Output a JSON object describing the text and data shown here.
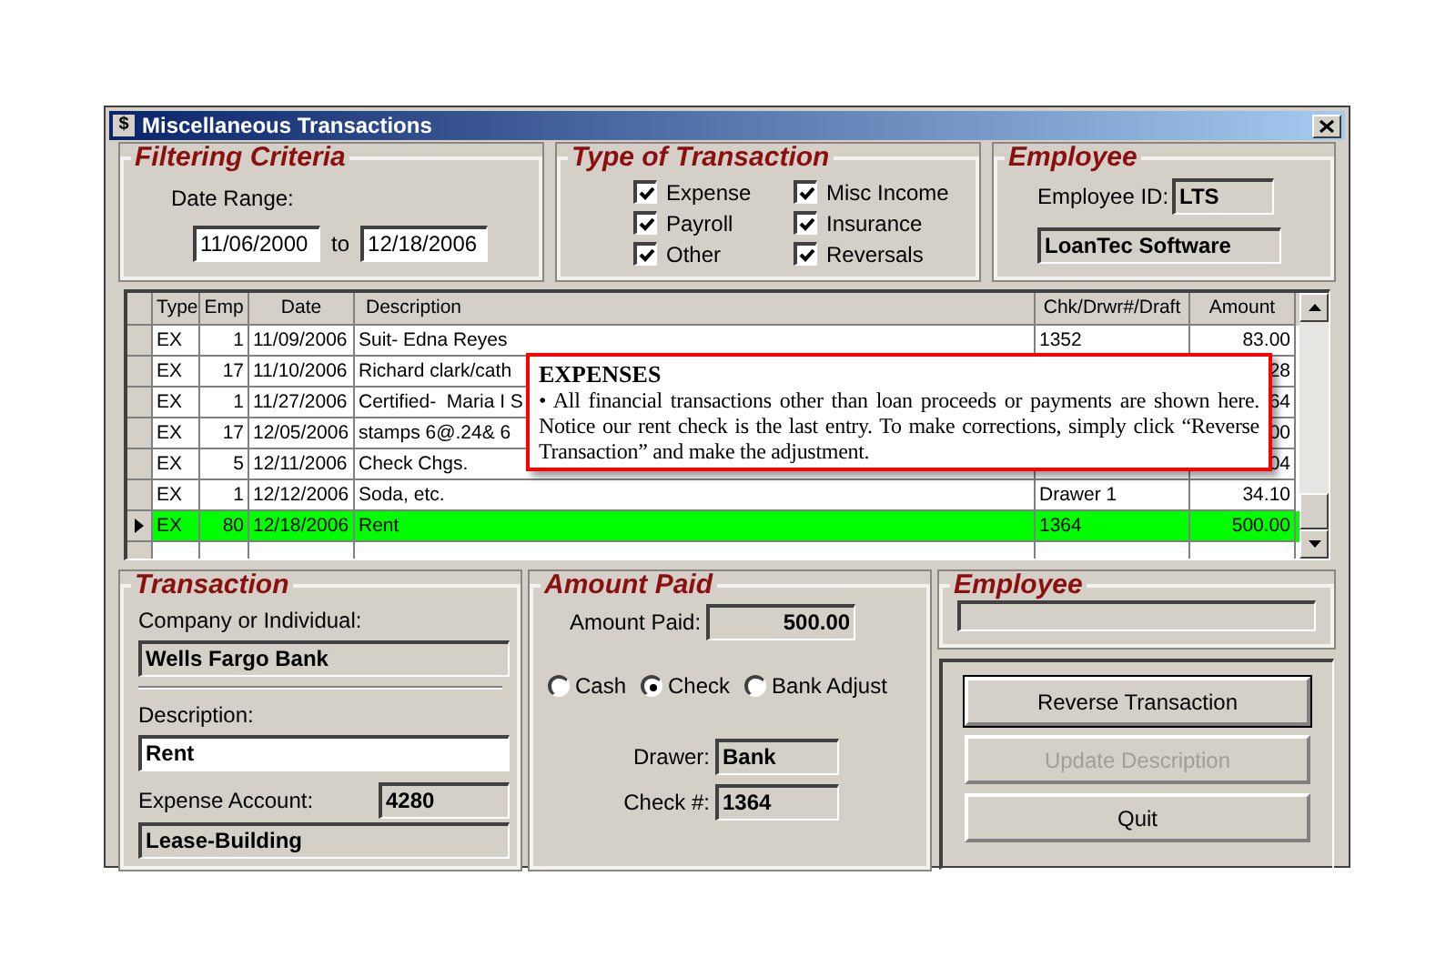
{
  "window": {
    "title": "Miscellaneous Transactions",
    "icon": "$"
  },
  "filtering": {
    "legend": "Filtering Criteria",
    "date_range_label": "Date Range:",
    "from": "11/06/2000",
    "to_label": "to",
    "to": "12/18/2006"
  },
  "transaction_types": {
    "legend": "Type of Transaction",
    "options": [
      {
        "label": "Expense",
        "checked": true
      },
      {
        "label": "Misc Income",
        "checked": true
      },
      {
        "label": "Payroll",
        "checked": true
      },
      {
        "label": "Insurance",
        "checked": true
      },
      {
        "label": "Other",
        "checked": true
      },
      {
        "label": "Reversals",
        "checked": true
      }
    ]
  },
  "employee": {
    "legend": "Employee",
    "id_label": "Employee ID:",
    "id_value": "LTS",
    "name_value": "LoanTec Software"
  },
  "table": {
    "columns": [
      "Type",
      "Emp",
      "Date",
      "Description",
      "Chk/Drwr#/Draft",
      "Amount"
    ],
    "rows": [
      {
        "type": "EX",
        "emp": "1",
        "date": "11/09/2006",
        "description": "Suit- Edna Reyes",
        "chk": "1352",
        "amount": "83.00",
        "selected": false
      },
      {
        "type": "EX",
        "emp": "17",
        "date": "11/10/2006",
        "description": "Richard clark/cath",
        "chk": "",
        "amount": "28",
        "selected": false
      },
      {
        "type": "EX",
        "emp": "1",
        "date": "11/27/2006",
        "description": "Certified-  Maria I S",
        "chk": "",
        "amount": "64",
        "selected": false
      },
      {
        "type": "EX",
        "emp": "17",
        "date": "12/05/2006",
        "description": "stamps 6@.24& 6",
        "chk": "",
        "amount": "00",
        "selected": false
      },
      {
        "type": "EX",
        "emp": "5",
        "date": "12/11/2006",
        "description": "Check Chgs.",
        "chk": "",
        "amount": "04",
        "selected": false
      },
      {
        "type": "EX",
        "emp": "1",
        "date": "12/12/2006",
        "description": "Soda, etc.",
        "chk": "Drawer 1",
        "amount": "34.10",
        "selected": false
      },
      {
        "type": "EX",
        "emp": "80",
        "date": "12/18/2006",
        "description": "Rent",
        "chk": "1364",
        "amount": "500.00",
        "selected": true
      }
    ]
  },
  "callout": {
    "title": "EXPENSES",
    "text": "• All financial transactions other than loan proceeds or payments are shown here. Notice our rent check is the last entry. To make corrections, simply click “Reverse Transaction” and make the adjustment."
  },
  "transaction": {
    "legend": "Transaction",
    "company_label": "Company or Individual:",
    "company": "Wells Fargo Bank",
    "description_label": "Description:",
    "description": "Rent",
    "account_label": "Expense Account:",
    "account_number": "4280",
    "account_name": "Lease-Building"
  },
  "amount_paid": {
    "legend": "Amount Paid",
    "amount_label": "Amount Paid:",
    "amount": "500.00",
    "methods": [
      {
        "label": "Cash",
        "selected": false
      },
      {
        "label": "Check",
        "selected": true
      },
      {
        "label": "Bank Adjust",
        "selected": false
      }
    ],
    "drawer_label": "Drawer:",
    "drawer": "Bank",
    "check_label": "Check #:",
    "check": "1364"
  },
  "employee_lower": {
    "legend": "Employee"
  },
  "buttons": [
    {
      "label": "Reverse Transaction",
      "disabled": false,
      "default": true
    },
    {
      "label": "Update Description",
      "disabled": true,
      "default": false
    },
    {
      "label": "Quit",
      "disabled": false,
      "default": false
    }
  ]
}
